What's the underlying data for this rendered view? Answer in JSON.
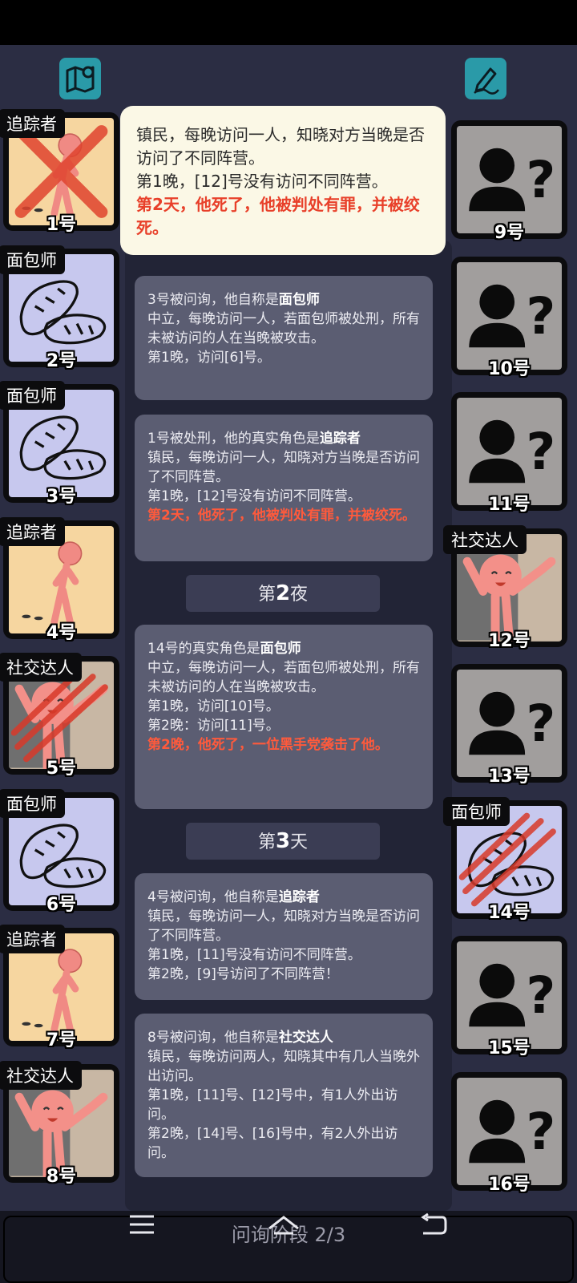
{
  "header": {
    "map_icon": "map-pin-icon",
    "note_icon": "edit-note-icon"
  },
  "left_players": [
    {
      "role": "追踪者",
      "number": "1号",
      "kind": "tracker",
      "status": "executed"
    },
    {
      "role": "面包师",
      "number": "2号",
      "kind": "baker",
      "status": "alive"
    },
    {
      "role": "面包师",
      "number": "3号",
      "kind": "baker",
      "status": "alive"
    },
    {
      "role": "追踪者",
      "number": "4号",
      "kind": "tracker",
      "status": "alive"
    },
    {
      "role": "社交达人",
      "number": "5号",
      "kind": "social",
      "status": "killed"
    },
    {
      "role": "面包师",
      "number": "6号",
      "kind": "baker",
      "status": "alive"
    },
    {
      "role": "追踪者",
      "number": "7号",
      "kind": "tracker",
      "status": "alive"
    },
    {
      "role": "社交达人",
      "number": "8号",
      "kind": "social",
      "status": "alive"
    }
  ],
  "right_players": [
    {
      "role": "",
      "number": "9号",
      "kind": "unknown",
      "status": "alive"
    },
    {
      "role": "",
      "number": "10号",
      "kind": "unknown",
      "status": "alive"
    },
    {
      "role": "",
      "number": "11号",
      "kind": "unknown",
      "status": "alive"
    },
    {
      "role": "社交达人",
      "number": "12号",
      "kind": "social",
      "status": "alive"
    },
    {
      "role": "",
      "number": "13号",
      "kind": "unknown",
      "status": "alive"
    },
    {
      "role": "面包师",
      "number": "14号",
      "kind": "baker",
      "status": "killed"
    },
    {
      "role": "",
      "number": "15号",
      "kind": "unknown",
      "status": "alive"
    },
    {
      "role": "",
      "number": "16号",
      "kind": "unknown",
      "status": "alive"
    }
  ],
  "tooltip": {
    "line1": "镇民，每晚访问一人，知晓对方当晚是否访问了不同阵营。",
    "line2": "第1晚，[12]号没有访问不同阵营。",
    "line3": "第2天，他死了，他被判处有罪，并被绞死。"
  },
  "log": {
    "msg1": {
      "prefix": "3号被问询，他自称是",
      "role": "面包师",
      "body": "中立，每晚访问一人，若面包师被处刑，所有未被访问的人在当晚被攻击。",
      "night1": "第1晚，访问[6]号。"
    },
    "msg2": {
      "prefix": "1号被处刑，他的真实角色是",
      "role": "追踪者",
      "body": "镇民，每晚访问一人，知晓对方当晚是否访问了不同阵营。",
      "night1": "第1晚，[12]号没有访问不同阵营。",
      "death": "第2天，他死了，他被判处有罪，并被绞死。"
    },
    "divider1": {
      "pre": "第",
      "num": "2",
      "post": "夜"
    },
    "msg3": {
      "prefix": "14号的真实角色是",
      "role": "面包师",
      "body": "中立，每晚访问一人，若面包师被处刑，所有未被访问的人在当晚被攻击。",
      "night1": "第1晚，访问[10]号。",
      "night2": "第2晚：访问[11]号。",
      "death": "第2晚，他死了，一位黑手党袭击了他。"
    },
    "divider2": {
      "pre": "第",
      "num": "3",
      "post": "天"
    },
    "msg4": {
      "prefix": "4号被问询，他自称是",
      "role": "追踪者",
      "body": "镇民，每晚访问一人，知晓对方当晚是否访问了不同阵营。",
      "night1": "第1晚，[11]号没有访问不同阵营。",
      "night2": "第2晚，[9]号访问了不同阵营！"
    },
    "msg5": {
      "prefix": "8号被问询，他自称是",
      "role": "社交达人",
      "body": "镇民，每晚访问两人，知晓其中有几人当晚外出访问。",
      "night1": "第1晚，[11]号、[12]号中，有1人外出访问。",
      "night2": "第2晚，[14]号、[16]号中，有2人外出访问。"
    }
  },
  "footer": {
    "phase": "问询阶段 2/3",
    "menu_icon": "menu-icon",
    "home_icon": "home-icon",
    "back_icon": "back-icon"
  }
}
